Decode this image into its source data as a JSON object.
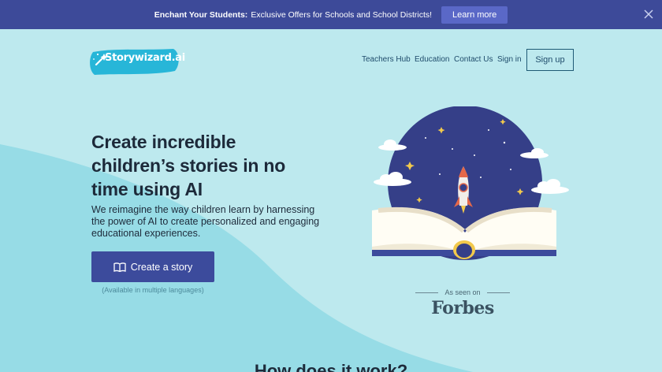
{
  "banner": {
    "bold_text": "Enchant Your Students:",
    "text": "Exclusive Offers for Schools and School Districts!",
    "button": "Learn more"
  },
  "logo": {
    "text": "Storywizard.ai"
  },
  "nav": {
    "items": [
      "Teachers Hub",
      "Education",
      "Contact Us",
      "Sign in"
    ],
    "signup": "Sign up"
  },
  "hero": {
    "headline": "Create incredible children’s stories in no time using AI",
    "subtitle": "We reimagine the way children learn by harnessing the power of AI to create personalized and engaging educational experiences.",
    "cta": "Create a story",
    "cta_note": "(Available in multiple languages)"
  },
  "press": {
    "label": "As seen on",
    "brand": "Forbes"
  },
  "next_section": {
    "title": "How does it work?"
  },
  "colors": {
    "banner": "#3d4a99",
    "accent": "#3c4b9c",
    "background": "#bde9ee"
  }
}
